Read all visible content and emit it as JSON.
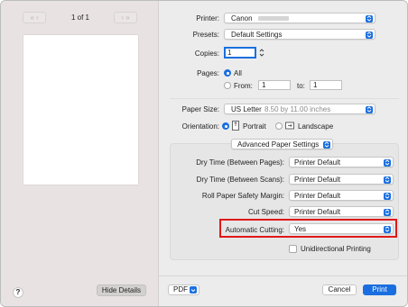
{
  "preview": {
    "page_counter": "1 of 1",
    "hide_details_label": "Hide Details",
    "help_label": "?"
  },
  "form": {
    "printer_label": "Printer:",
    "printer_value": "Canon",
    "presets_label": "Presets:",
    "presets_value": "Default Settings",
    "copies_label": "Copies:",
    "copies_value": "1",
    "pages_label": "Pages:",
    "pages_all_label": "All",
    "pages_from_label": "From:",
    "pages_from_value": "1",
    "pages_to_label": "to:",
    "pages_to_value": "1",
    "paper_size_label": "Paper Size:",
    "paper_size_value": "US Letter",
    "paper_size_dims": "8.50 by 11.00 inches",
    "orientation_label": "Orientation:",
    "portrait_label": "Portrait",
    "landscape_label": "Landscape",
    "section_value": "Advanced Paper Settings"
  },
  "advanced": {
    "rows": [
      {
        "label": "Dry Time (Between Pages):",
        "value": "Printer Default"
      },
      {
        "label": "Dry Time (Between Scans):",
        "value": "Printer Default"
      },
      {
        "label": "Roll Paper Safety Margin:",
        "value": "Printer Default"
      },
      {
        "label": "Cut Speed:",
        "value": "Printer Default"
      },
      {
        "label": "Automatic Cutting:",
        "value": "Yes"
      }
    ],
    "unidirectional_label": "Unidirectional Printing"
  },
  "footer": {
    "pdf_label": "PDF",
    "cancel_label": "Cancel",
    "print_label": "Print"
  },
  "colors": {
    "accent": "#1a6fe0",
    "highlight": "#e01818"
  }
}
